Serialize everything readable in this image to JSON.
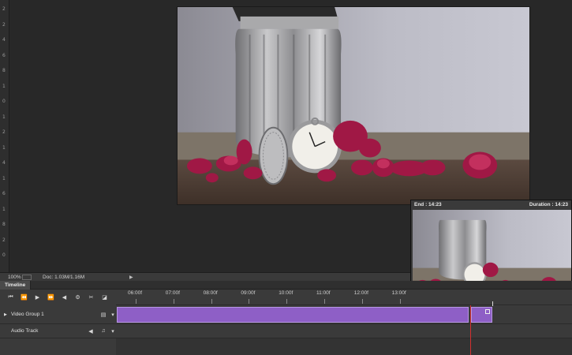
{
  "ruler_vertical": [
    "2",
    "2",
    "4",
    "6",
    "8",
    "1",
    "0",
    "1",
    "2",
    "1",
    "4",
    "1",
    "6",
    "1",
    "8",
    "2",
    "0"
  ],
  "status": {
    "zoom": "100%",
    "doc": "Doc: 1.03M/1.16M"
  },
  "preview": {
    "end": "End : 14:23",
    "duration": "Duration : 14:23"
  },
  "timeline": {
    "tab": "Timeline",
    "ruler_labels": [
      "06:00f",
      "07:00f",
      "08:00f",
      "09:00f",
      "10:00f",
      "11:00f",
      "12:00f",
      "13:00f"
    ],
    "tracks": [
      {
        "name": "Video Group 1"
      },
      {
        "name": "Audio Track"
      }
    ]
  },
  "icons": {
    "go_first": "⏮",
    "step_back": "⏪",
    "play": "▶",
    "step_fwd": "⏩",
    "audio": "◀",
    "settings": "⚙",
    "cut": "✂",
    "transition": "◪",
    "film": "▤",
    "music": "♫",
    "chevron": "▾"
  },
  "colors": {
    "clip": "#8e5fc6",
    "playhead": "#d2302f",
    "bg": "#282828"
  }
}
